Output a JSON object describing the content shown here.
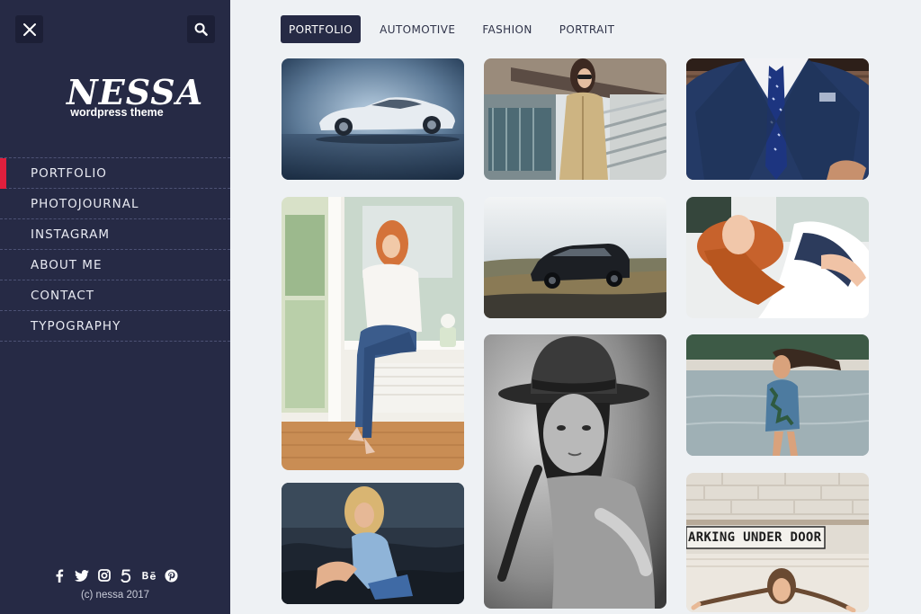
{
  "sidebar": {
    "logo_main": "NESSA",
    "logo_sub": "wordpress theme",
    "nav": [
      "PORTFOLIO",
      "PHOTOJOURNAL",
      "INSTAGRAM",
      "ABOUT ME",
      "CONTACT",
      "TYPOGRAPHY"
    ],
    "active_nav": "PORTFOLIO",
    "social_icons": [
      "facebook-icon",
      "twitter-icon",
      "instagram-icon",
      "500px-icon",
      "behance-icon",
      "pinterest-icon"
    ],
    "copyright": "(c) nessa 2017"
  },
  "filters": {
    "tabs": [
      "PORTFOLIO",
      "AUTOMOTIVE",
      "FASHION",
      "PORTRAIT"
    ],
    "active": "PORTFOLIO"
  },
  "gallery": {
    "sign_text": "ARKING UNDER DOOR"
  },
  "colors": {
    "sidebar_bg": "#262a45",
    "accent": "#e01f3d",
    "page_bg": "#eef1f4"
  }
}
